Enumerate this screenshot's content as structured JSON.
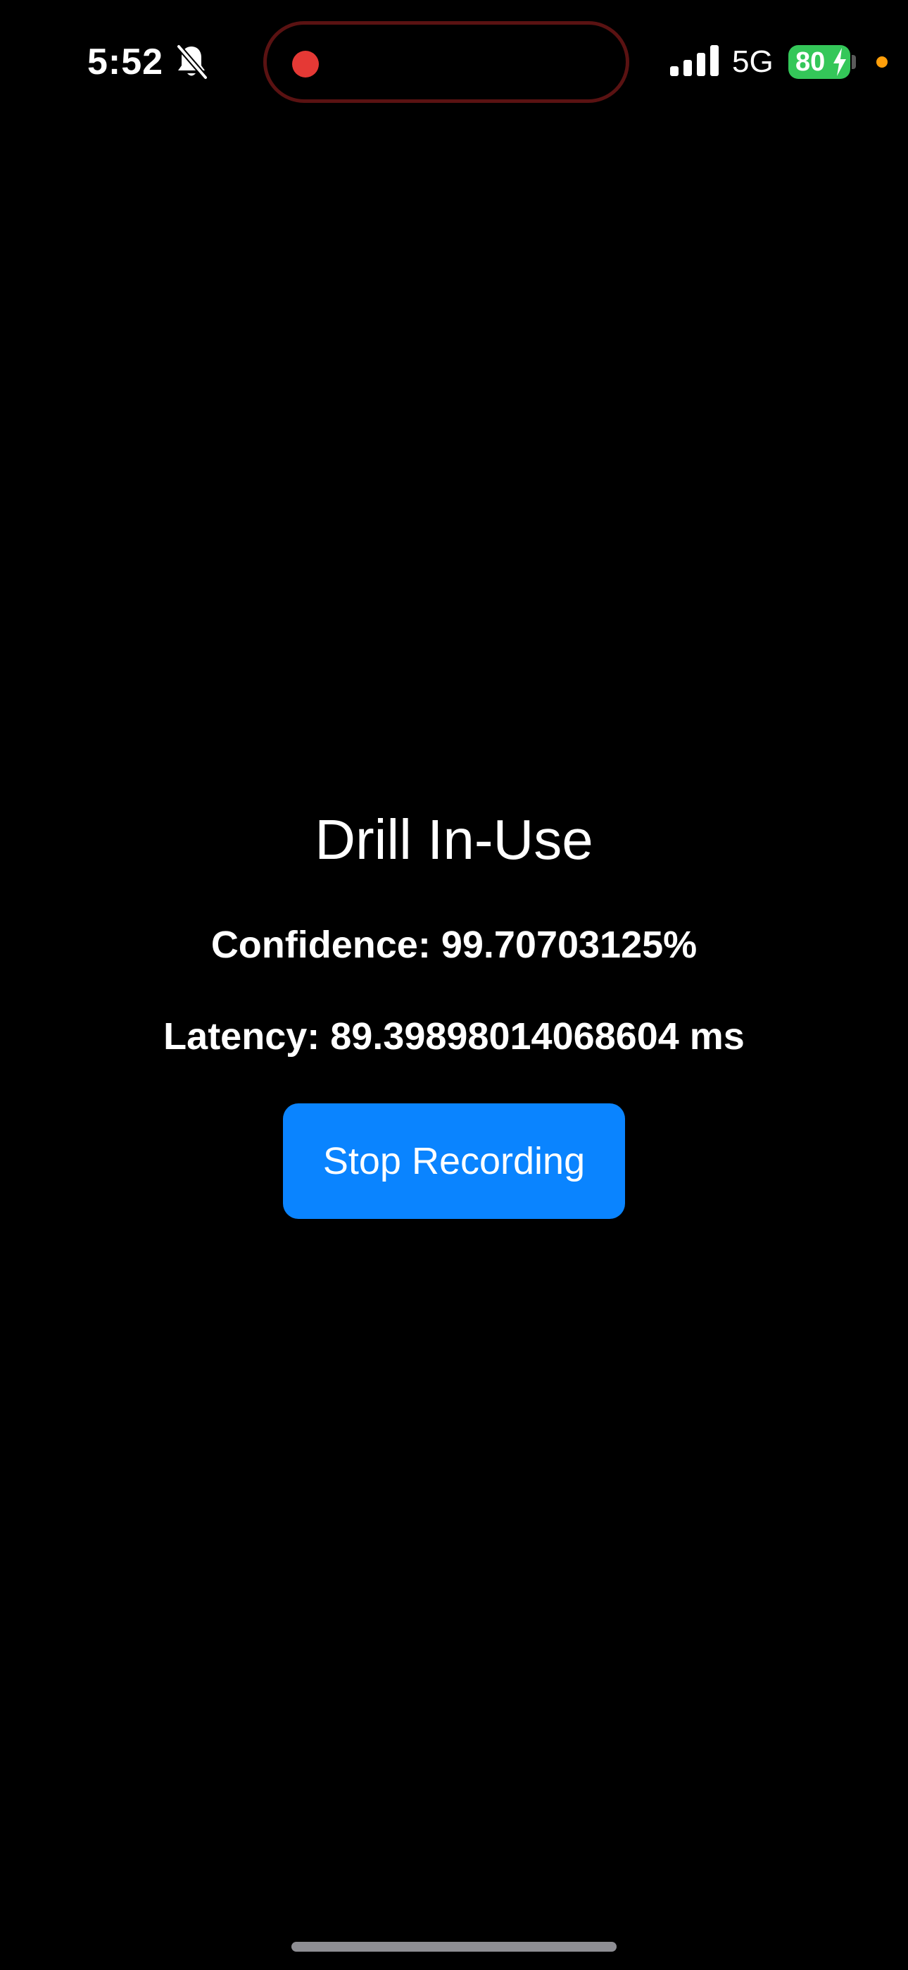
{
  "status_bar": {
    "time": "5:52",
    "silent_icon": "bell-slash-icon",
    "recording_indicator_color": "#e53935",
    "signal_icon": "cellular-signal-icon",
    "network": "5G",
    "battery_level": "80",
    "battery_color": "#34c759",
    "mic_indicator_color": "#ff9f0a"
  },
  "main": {
    "title": "Drill In-Use",
    "confidence": "Confidence: 99.70703125%",
    "latency": "Latency: 89.39898014068604 ms",
    "stop_button_label": "Stop Recording",
    "button_color": "#0a84ff"
  }
}
